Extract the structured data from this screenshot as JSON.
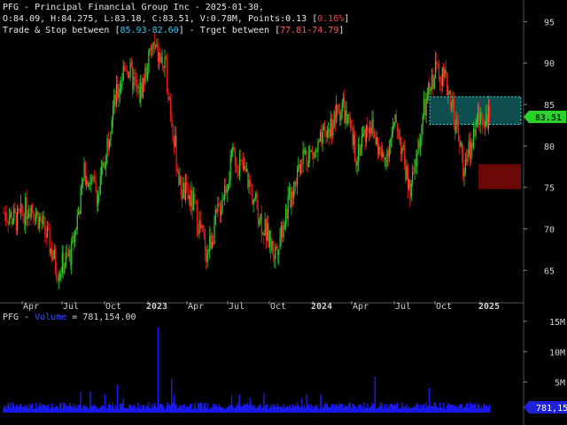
{
  "header": {
    "line1": "PFG - Principal Financial Group Inc - 2025-01-30,",
    "ohlc": "O:84.09, H:84.275, L:83.18, C:83.51, V:0.78M, Points:0.13",
    "pct": "0.16%",
    "line3a": "Trade & Stop between ",
    "trade": "85.93-82.60",
    "line3b": " - Trget between ",
    "target": "77.81-74.79"
  },
  "volume_header": {
    "prefix": "PFG - ",
    "label": "Volume",
    "value": " = 781,154.00"
  },
  "colors": {
    "up": "#2bd12b",
    "down": "#ff1a1a",
    "volume": "#1a1aff",
    "trade_zone": "#0d4f4f",
    "target_zone": "#6a0808",
    "price_tag": "#2bd12b",
    "grid": "#1a1a1a"
  },
  "chart_data": [
    {
      "type": "candlestick",
      "y_ticks": [
        95,
        90,
        85,
        80,
        75,
        70,
        65
      ],
      "ylim": [
        61.3,
        97.6
      ],
      "x_ticks": [
        "Apr",
        "Jul",
        "Oct",
        "2023",
        "Apr",
        "Jul",
        "Oct",
        "2024",
        "Apr",
        "Jul",
        "Oct",
        "2025"
      ],
      "last_price": "83.51",
      "trade_zone": [
        82.6,
        85.93
      ],
      "target_zone": [
        74.79,
        77.81
      ],
      "series": [
        {
          "month": "2022-02",
          "close": 72
        },
        {
          "month": "2022-03",
          "close": 71
        },
        {
          "month": "2022-04",
          "close": 73
        },
        {
          "month": "2022-05",
          "close": 70
        },
        {
          "month": "2022-06",
          "close": 65
        },
        {
          "month": "2022-07",
          "close": 67
        },
        {
          "month": "2022-08",
          "close": 77
        },
        {
          "month": "2022-09",
          "close": 74
        },
        {
          "month": "2022-10",
          "close": 84
        },
        {
          "month": "2022-11",
          "close": 90
        },
        {
          "month": "2022-12",
          "close": 86
        },
        {
          "month": "2023-01",
          "close": 92
        },
        {
          "month": "2023-02",
          "close": 89
        },
        {
          "month": "2023-03",
          "close": 75
        },
        {
          "month": "2023-04",
          "close": 73
        },
        {
          "month": "2023-05",
          "close": 67
        },
        {
          "month": "2023-06",
          "close": 73
        },
        {
          "month": "2023-07",
          "close": 79
        },
        {
          "month": "2023-08",
          "close": 76
        },
        {
          "month": "2023-09",
          "close": 71
        },
        {
          "month": "2023-10",
          "close": 67
        },
        {
          "month": "2023-11",
          "close": 73
        },
        {
          "month": "2023-12",
          "close": 79
        },
        {
          "month": "2024-01",
          "close": 79
        },
        {
          "month": "2024-02",
          "close": 82
        },
        {
          "month": "2024-03",
          "close": 85
        },
        {
          "month": "2024-04",
          "close": 79
        },
        {
          "month": "2024-05",
          "close": 83
        },
        {
          "month": "2024-06",
          "close": 78
        },
        {
          "month": "2024-07",
          "close": 83
        },
        {
          "month": "2024-08",
          "close": 74
        },
        {
          "month": "2024-09",
          "close": 84
        },
        {
          "month": "2024-10",
          "close": 90
        },
        {
          "month": "2024-11",
          "close": 86
        },
        {
          "month": "2024-12",
          "close": 77
        },
        {
          "month": "2025-01",
          "close": 83.51
        }
      ]
    },
    {
      "type": "bar",
      "title": "Volume",
      "y_ticks": [
        "15M",
        "10M",
        "5M"
      ],
      "ylim": [
        0,
        16000000
      ],
      "last_value": "781,154",
      "typical_value": 1200000,
      "spikes": [
        {
          "month": "2022-08",
          "value": 3500000
        },
        {
          "month": "2022-10",
          "value": 4500000
        },
        {
          "month": "2023-01",
          "value": 14000000
        },
        {
          "month": "2023-02",
          "value": 5500000
        },
        {
          "month": "2023-07",
          "value": 3000000
        },
        {
          "month": "2024-01",
          "value": 3000000
        },
        {
          "month": "2024-05",
          "value": 6000000
        },
        {
          "month": "2024-09",
          "value": 4000000
        }
      ]
    }
  ]
}
